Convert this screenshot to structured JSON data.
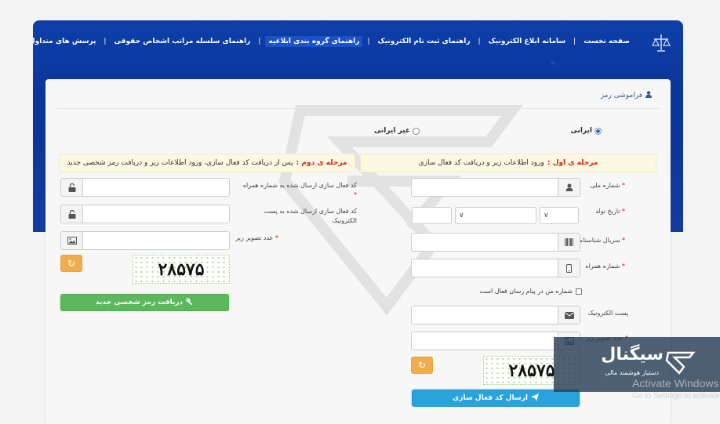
{
  "nav": {
    "items": [
      {
        "label": "صفحه نخست"
      },
      {
        "label": "سامانه ابلاغ الکترونیک"
      },
      {
        "label": "راهنمای ثبت نام الکترونیک"
      },
      {
        "label": "راهنمای گروه بندی ابلاغیه"
      },
      {
        "label": "راهنمای سلسله مراتب اشخاص حقوقی"
      },
      {
        "label": "پرسش های متداول"
      }
    ],
    "separator": "|"
  },
  "card": {
    "title": "فراموشی رمز"
  },
  "radio": {
    "iranian": "ایرانی",
    "non_iranian": "غیر ایرانی",
    "selected": "iranian"
  },
  "step1": {
    "prefix": "مرحله ی اول :",
    "text": "ورود اطلاعات زیر و دریافت کد فعال سازی"
  },
  "step2": {
    "prefix": "مرحله ی دوم :",
    "text": "پس از دریافت کد فعال سازی، ورود اطلاعات زیر و دریافت رمز شخصی جدید"
  },
  "right_form": {
    "national_code": "شماره ملی",
    "birth_date": "تاریخ تولد",
    "id_serial": "سریال شناسنامه",
    "mobile": "شماره همراه",
    "checkbox_label": "شماره من در پیام رسان فعال است",
    "email": "پست الکترونیک",
    "captcha_label": "عدد تصویر زیر",
    "captcha_value": "۲۸۵۷۵",
    "submit": "ارسال کد فعال سازی",
    "star": "*"
  },
  "left_form": {
    "code_mobile": "کد فعال سازی ارسال شده به شماره همراه",
    "code_email": "کد فعال سازی ارسال شده به پست الکترونیک",
    "captcha_label": "عدد تصویر زیر",
    "captcha_value": "۲۸۵۷۵",
    "submit": "دریافت رمز شخصی جدید",
    "star": "*"
  },
  "overlay": {
    "brand": "سیگنال",
    "tagline": "دستیار هوشمند مالی"
  },
  "windows": {
    "line1": "Activate Windows",
    "line2": "Go to Settings to activate"
  },
  "colors": {
    "header": "#0d3fa8",
    "green": "#5cb85c",
    "blue": "#29a3dc",
    "orange": "#f0ad4e",
    "red": "#d9230f"
  }
}
